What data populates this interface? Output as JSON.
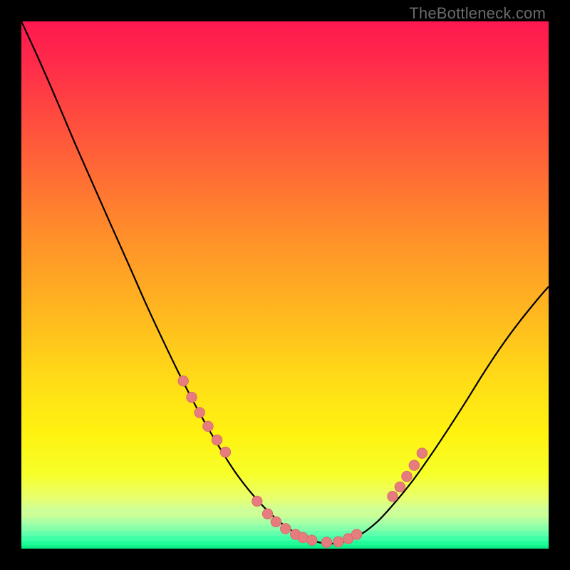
{
  "watermark": "TheBottleneck.com",
  "colors": {
    "background": "#000000",
    "curve": "#000000",
    "dot_fill": "#e77c7e",
    "dot_stroke": "#d86b6d",
    "gradient_stops": [
      {
        "offset": 0.0,
        "color": "#ff1850"
      },
      {
        "offset": 0.08,
        "color": "#ff2b4a"
      },
      {
        "offset": 0.18,
        "color": "#ff4a3f"
      },
      {
        "offset": 0.3,
        "color": "#ff6f34"
      },
      {
        "offset": 0.42,
        "color": "#ff9329"
      },
      {
        "offset": 0.55,
        "color": "#ffb71f"
      },
      {
        "offset": 0.68,
        "color": "#ffdc17"
      },
      {
        "offset": 0.78,
        "color": "#fff210"
      },
      {
        "offset": 0.86,
        "color": "#f7ff2a"
      },
      {
        "offset": 0.905,
        "color": "#e8ff70"
      },
      {
        "offset": 0.93,
        "color": "#c9ffa0"
      },
      {
        "offset": 0.955,
        "color": "#8fffb0"
      },
      {
        "offset": 0.975,
        "color": "#4dffad"
      },
      {
        "offset": 0.99,
        "color": "#1dff9a"
      },
      {
        "offset": 1.0,
        "color": "#07f086"
      }
    ],
    "bottom_bands": [
      {
        "y": 0.93,
        "color": "#d9ff8c"
      },
      {
        "y": 0.942,
        "color": "#b8ff9c"
      },
      {
        "y": 0.954,
        "color": "#93ffa6"
      },
      {
        "y": 0.966,
        "color": "#6bffab"
      },
      {
        "y": 0.976,
        "color": "#44ffa6"
      },
      {
        "y": 0.986,
        "color": "#21fa97"
      },
      {
        "y": 0.994,
        "color": "#0be784"
      }
    ]
  },
  "chart_data": {
    "type": "line",
    "title": "",
    "xlabel": "",
    "ylabel": "",
    "xlim": [
      0,
      1
    ],
    "ylim": [
      0,
      1
    ],
    "grid": false,
    "legend": false,
    "series": [
      {
        "name": "bottleneck-curve",
        "x": [
          0.0,
          0.034,
          0.068,
          0.101,
          0.135,
          0.169,
          0.203,
          0.236,
          0.27,
          0.304,
          0.338,
          0.372,
          0.405,
          0.439,
          0.473,
          0.507,
          0.541,
          0.574,
          0.608,
          0.642,
          0.676,
          0.709,
          0.743,
          0.777,
          0.811,
          0.845,
          0.878,
          0.912,
          0.946,
          0.98,
          1.0
        ],
        "y": [
          1.0,
          0.926,
          0.848,
          0.77,
          0.693,
          0.616,
          0.54,
          0.465,
          0.392,
          0.322,
          0.257,
          0.198,
          0.146,
          0.102,
          0.066,
          0.038,
          0.02,
          0.01,
          0.012,
          0.026,
          0.052,
          0.088,
          0.13,
          0.178,
          0.229,
          0.282,
          0.335,
          0.386,
          0.432,
          0.474,
          0.497
        ]
      }
    ],
    "highlight_dots": {
      "name": "highlighted-points",
      "x": [
        0.307,
        0.323,
        0.338,
        0.354,
        0.371,
        0.387,
        0.447,
        0.467,
        0.483,
        0.501,
        0.52,
        0.534,
        0.551,
        0.579,
        0.601,
        0.62,
        0.636,
        0.704,
        0.718,
        0.731,
        0.745,
        0.76
      ],
      "y": [
        0.318,
        0.287,
        0.258,
        0.232,
        0.206,
        0.183,
        0.09,
        0.066,
        0.051,
        0.038,
        0.027,
        0.021,
        0.016,
        0.012,
        0.013,
        0.019,
        0.027,
        0.099,
        0.117,
        0.137,
        0.158,
        0.181
      ]
    }
  }
}
